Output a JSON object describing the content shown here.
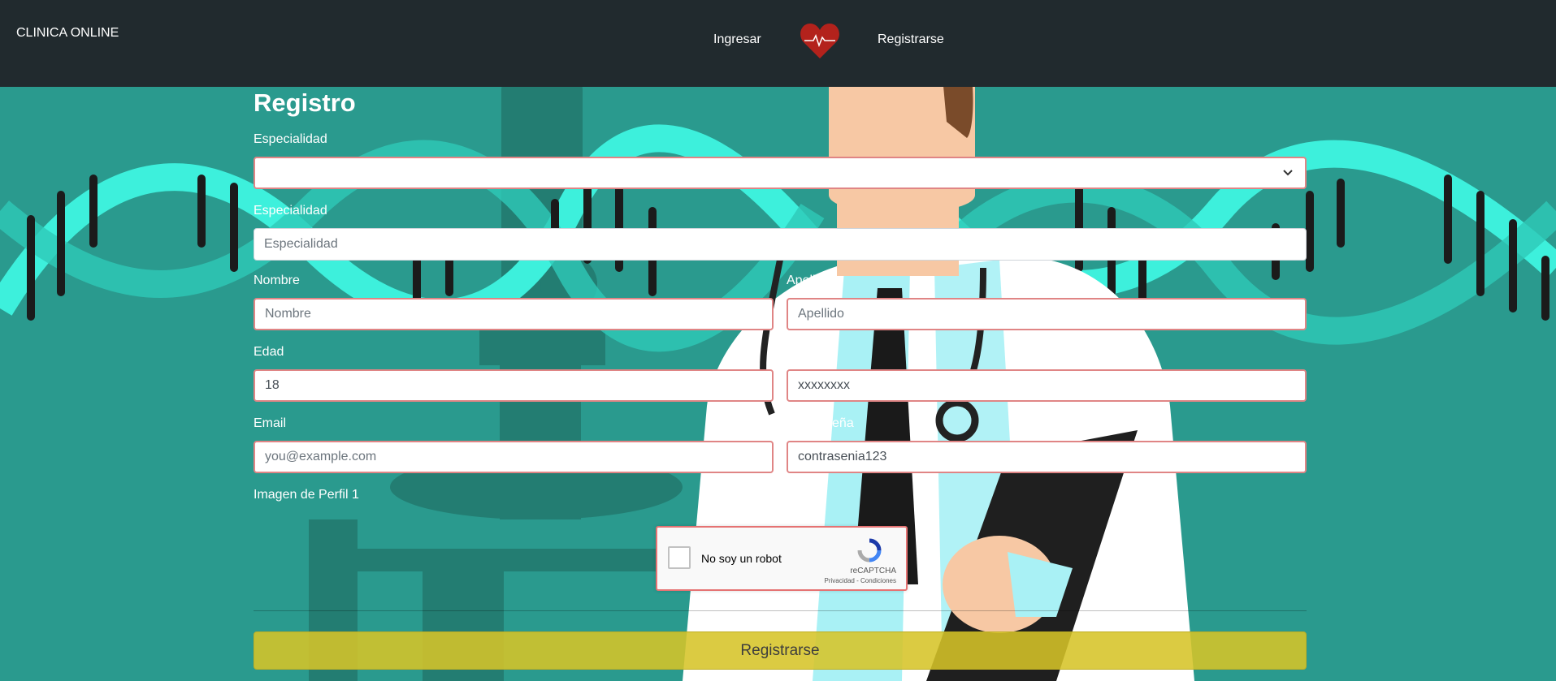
{
  "nav": {
    "brand": "CLINICA ONLINE",
    "login": "Ingresar",
    "register": "Registrarse"
  },
  "form": {
    "title": "Registro",
    "especialidad_select_label": "Especialidad",
    "especialidad_select_value": "",
    "especialidad_label": "Especialidad",
    "especialidad_placeholder": "Especialidad",
    "nombre_label": "Nombre",
    "nombre_placeholder": "Nombre",
    "apellido_label": "Apellido",
    "apellido_placeholder": "Apellido",
    "edad_label": "Edad",
    "edad_value": "18",
    "dni_value": "xxxxxxxx",
    "email_label": "Email",
    "email_placeholder": "you@example.com",
    "password_label": "Contraseña",
    "password_value": "contrasenia123",
    "image_label": "Imagen de Perfil 1",
    "submit": "Registrarse"
  },
  "captcha": {
    "checkbox_label": "No soy un robot",
    "brand": "reCAPTCHA",
    "links": "Privacidad - Condiciones"
  },
  "colors": {
    "navbar": "#212a2e",
    "background": "#2a9a8e",
    "field_border": "#e08585",
    "submit": "#d6c428"
  }
}
